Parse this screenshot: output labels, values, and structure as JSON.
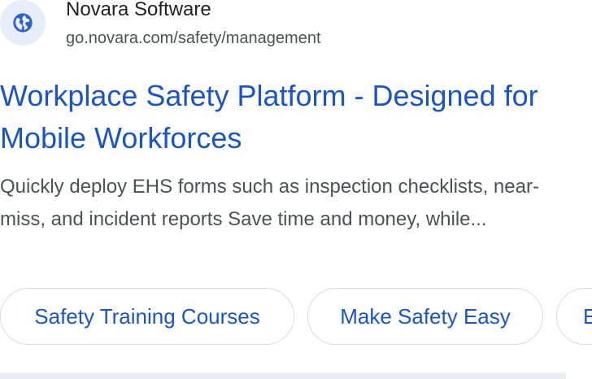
{
  "site": {
    "name": "Novara Software",
    "url": "go.novara.com/safety/management",
    "icon": "globe-icon"
  },
  "result": {
    "title": "Workplace Safety Platform - Designed for Mobile Workforces",
    "snippet": "Quickly deploy EHS forms such as inspection checklists, near-miss, and incident reports Save time and money, while..."
  },
  "chips": [
    {
      "label": "Safety Training Courses"
    },
    {
      "label": "Make Safety Easy"
    },
    {
      "label": "E"
    }
  ],
  "colors": {
    "link": "#1a55c8",
    "icon_bg": "#e8eef9",
    "icon_fg": "#2d63c8"
  }
}
